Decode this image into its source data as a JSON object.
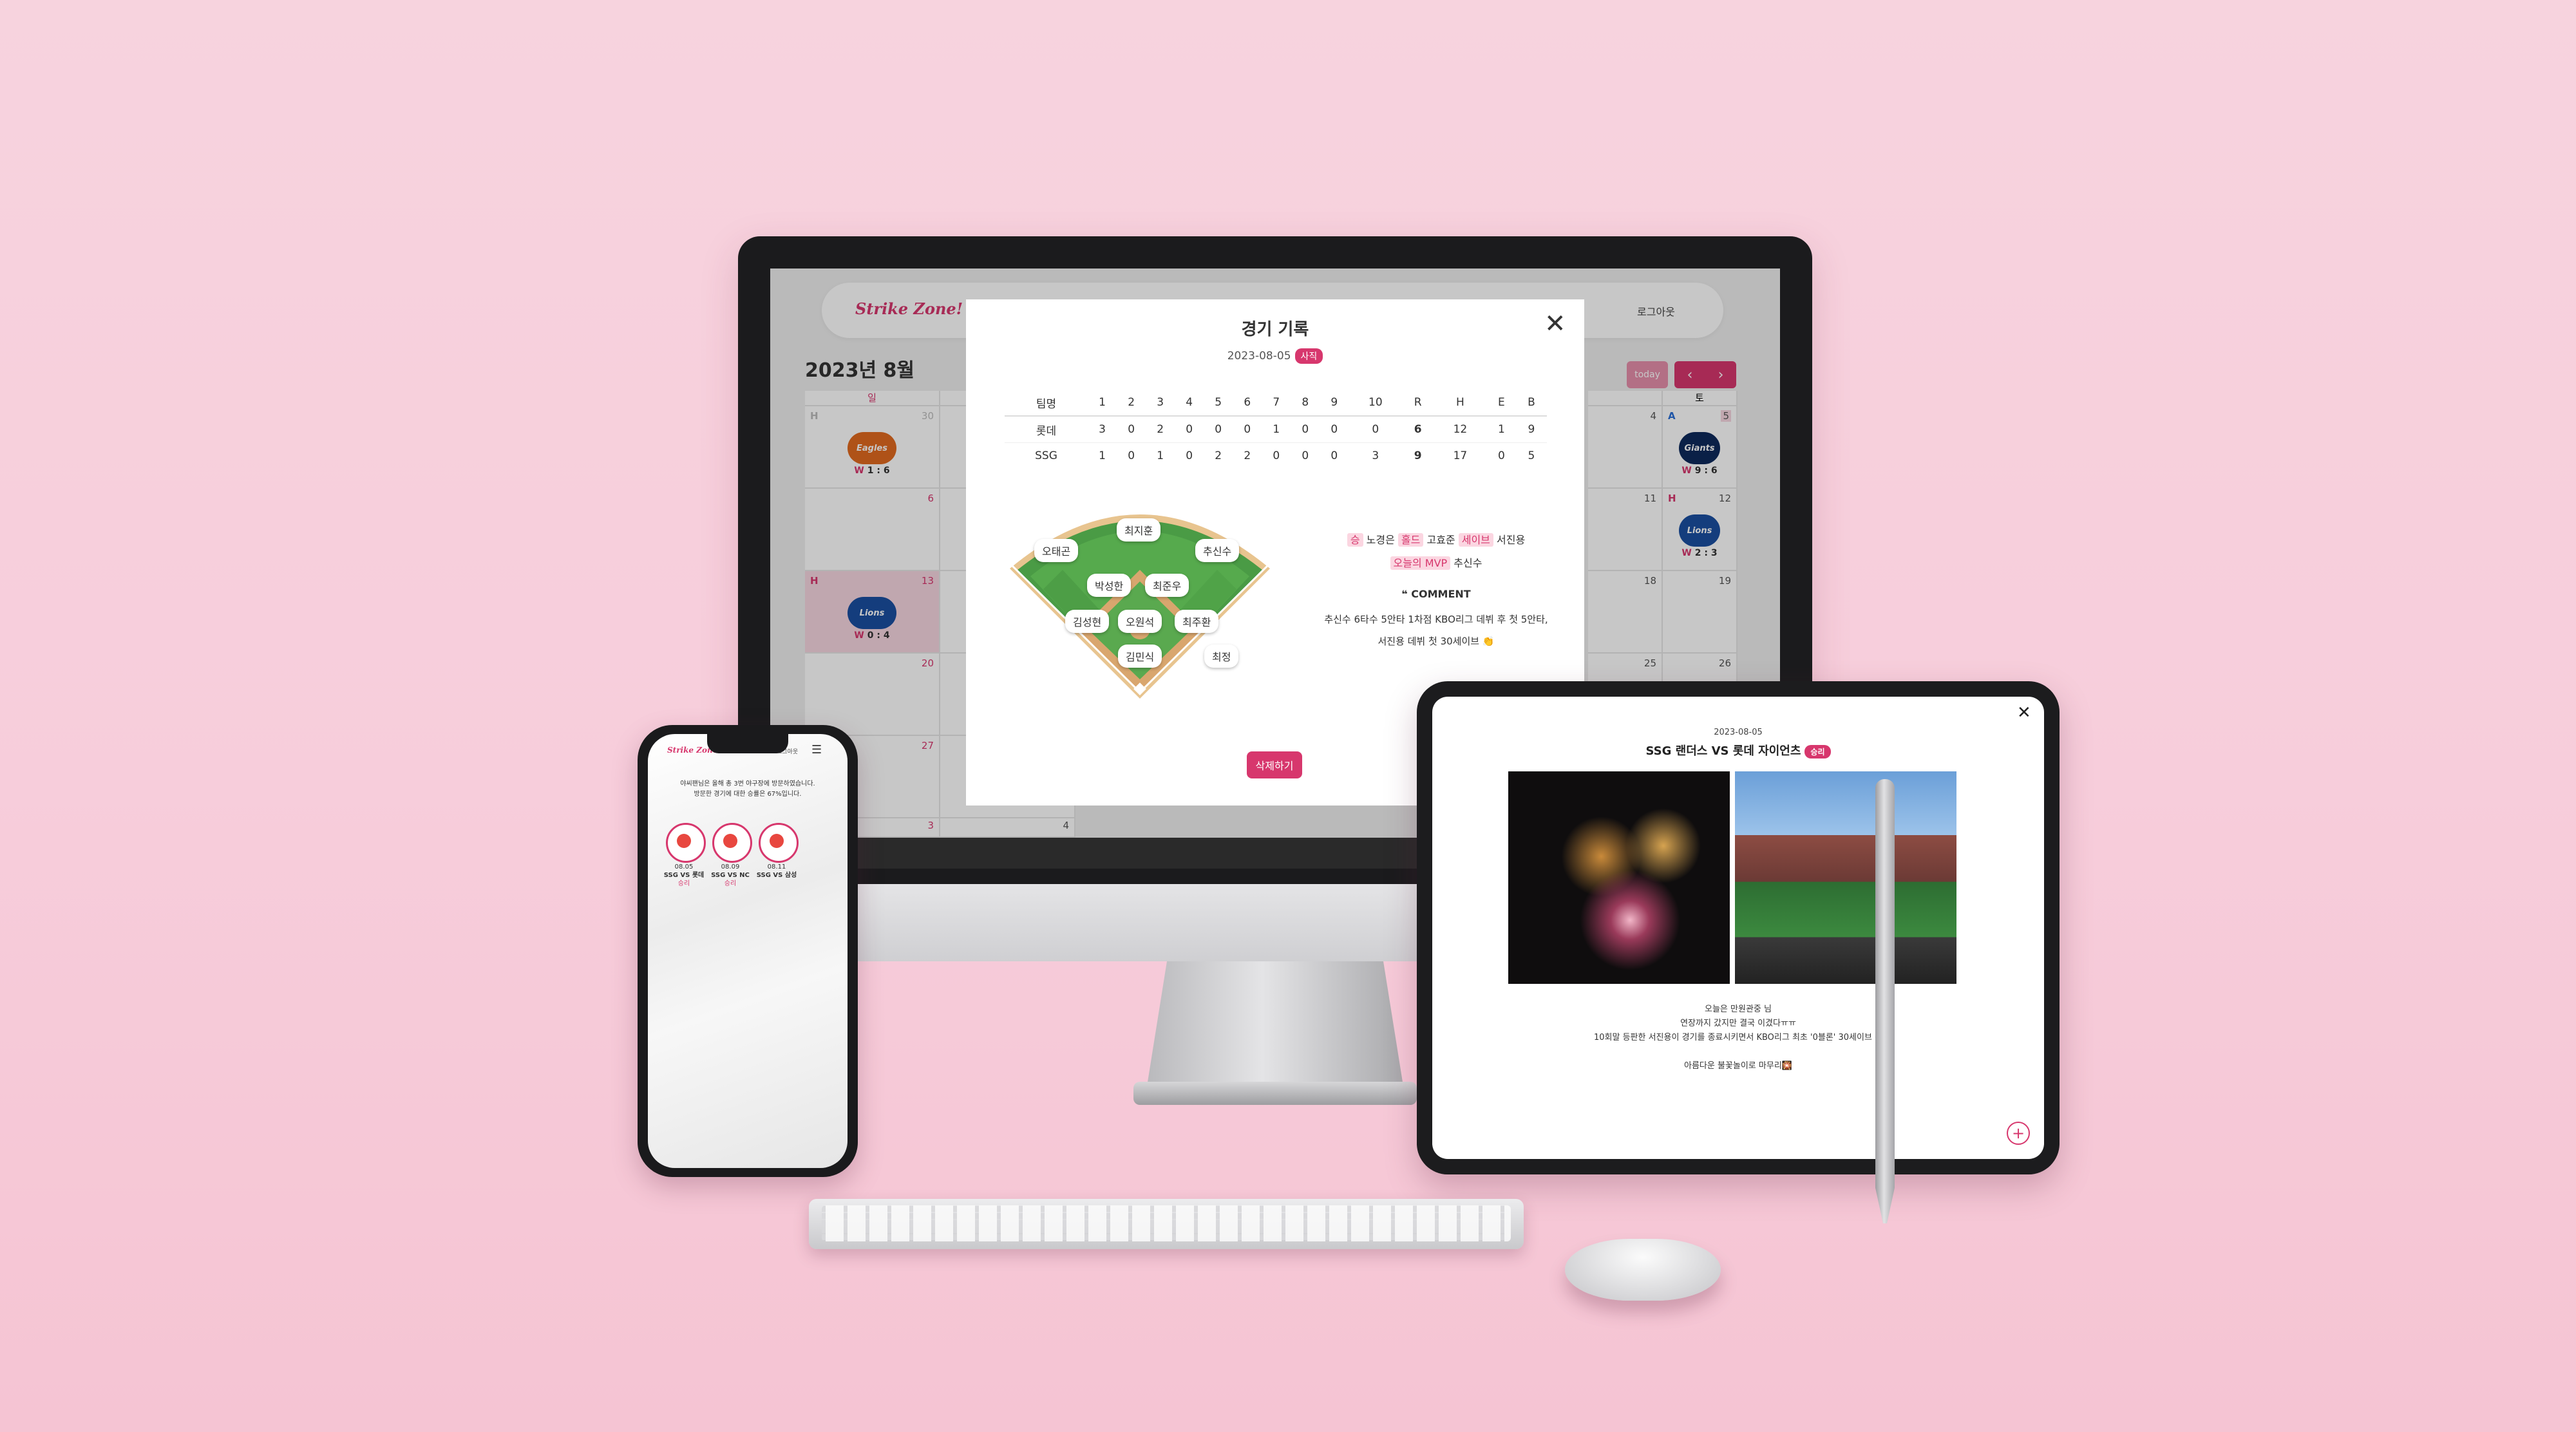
{
  "calendar": {
    "logo": "Strike Zone!",
    "logout": "로그아웃",
    "month_title": "2023년 8월",
    "today": "today",
    "prev": "‹",
    "next": "›",
    "weekday_sun": "일",
    "weekday_sat": "토",
    "cells": {
      "c30": "30",
      "c6": "6",
      "c13": "13",
      "c20": "20",
      "c27": "27",
      "c3": "3",
      "c4": "4",
      "c5": "5",
      "c11": "11",
      "c12": "12",
      "c18": "18",
      "c19": "19",
      "c25": "25",
      "c26": "26",
      "b4": "4",
      "b5": "5",
      "b6": "6"
    },
    "tags": {
      "h": "H",
      "a": "A"
    },
    "scores": {
      "s1_w": "W",
      "s1": "1 : 6",
      "s13_w": "W",
      "s13": "0 : 4",
      "s5_w": "W",
      "s5": "9 : 6",
      "s12_w": "W",
      "s12": "2 : 3"
    },
    "logos": {
      "eagles": "Eagles",
      "giants": "Giants",
      "lions": "Lions"
    }
  },
  "modal": {
    "title": "경기 기록",
    "date": "2023-08-05",
    "team_badge": "사직",
    "close": "✕",
    "header": [
      "팀명",
      "1",
      "2",
      "3",
      "4",
      "5",
      "6",
      "7",
      "8",
      "9",
      "10",
      "R",
      "H",
      "E",
      "B"
    ],
    "rows": [
      [
        "롯데",
        "3",
        "0",
        "2",
        "0",
        "0",
        "0",
        "1",
        "0",
        "0",
        "0",
        "6",
        "12",
        "1",
        "9"
      ],
      [
        "SSG",
        "1",
        "0",
        "1",
        "0",
        "2",
        "2",
        "0",
        "0",
        "0",
        "3",
        "9",
        "17",
        "0",
        "5"
      ]
    ],
    "positions": {
      "cf": "최지훈",
      "lf": "오태곤",
      "rf": "추신수",
      "ss": "박성한",
      "2b": "최준우",
      "3b": "김성현",
      "p": "오원석",
      "1b": "최주환",
      "c": "김민식",
      "dh": "최정"
    },
    "stats": {
      "win_label": "승",
      "win": "노경은",
      "hold_label": "홀드",
      "hold": "고효준",
      "save_label": "세이브",
      "save": "서진용",
      "mvp_label": "오늘의 MVP",
      "mvp": "추신수"
    },
    "comment_title": "COMMENT",
    "comment_line1": "추신수 6타수 5안타 1차점 KBO리그 데뷔 후 첫 5안타,",
    "comment_line2": "서진용 데뷔 첫 30세이브 👏",
    "delete": "삭제하기"
  },
  "phone": {
    "logo": "Strike Zone!",
    "logout": "로그아웃",
    "menu_icon": "hamburger-icon",
    "line1": "야씨팬님은 올해 총 3번 야구장에 방문하였습니다.",
    "line2": "방문한 경기에 대한 승률은 67%입니다.",
    "badges": [
      {
        "date": "08.05",
        "match": "SSG VS 롯데",
        "result": "승리"
      },
      {
        "date": "08.09",
        "match": "SSG VS NC",
        "result": "승리"
      },
      {
        "date": "08.11",
        "match": "SSG VS 삼성",
        "result": ""
      }
    ]
  },
  "tablet": {
    "close": "✕",
    "date": "2023-08-05",
    "title": "SSG 랜더스 VS 롯데 자이언츠",
    "result": "승리",
    "text1": "오늘은 만원관중 님",
    "text2": "연장까지 갔지만 결국 이겼다ㅠㅠ",
    "text3": "10회말 등판한 서진용이 경기를 종료시키면서 KBO리그 최초 '0블론' 30세이브 선",
    "text4": "아름다운 불꽃놀이로 마무리🎇",
    "add": "+"
  },
  "colors": {
    "accent": "#d7376d",
    "background": "#f7d3de"
  }
}
